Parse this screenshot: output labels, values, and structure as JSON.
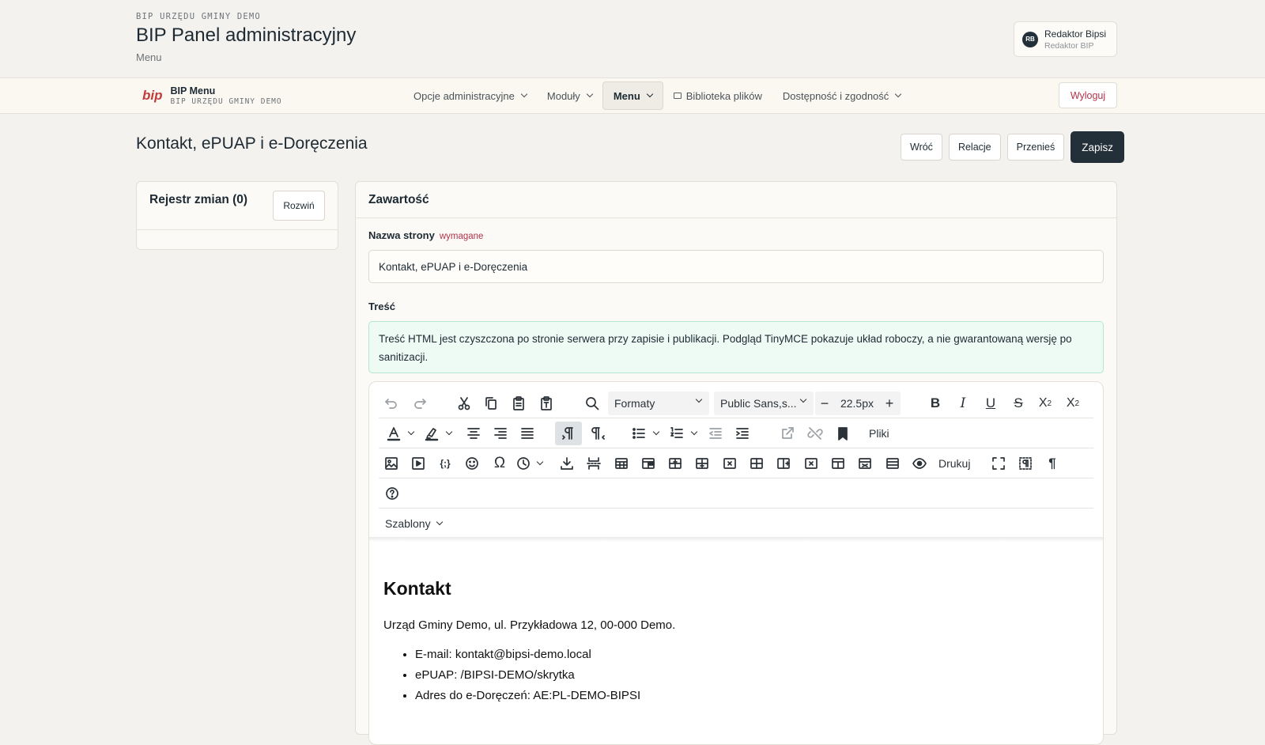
{
  "header": {
    "org": "BIP URZĘDU GMINY DEMO",
    "title": "BIP Panel administracyjny",
    "subtitle": "Menu",
    "user": {
      "initials": "RB",
      "name": "Redaktor Bipsi",
      "role": "Redaktor BIP"
    }
  },
  "nav": {
    "logo": "bip",
    "brand_name": "BIP Menu",
    "brand_org": "BIP URZĘDU GMINY DEMO",
    "items": [
      {
        "label": "Opcje administracyjne"
      },
      {
        "label": "Moduły"
      },
      {
        "label": "Menu",
        "active": true
      },
      {
        "label": "Biblioteka plików"
      },
      {
        "label": "Dostępność i zgodność"
      }
    ],
    "logout": "Wyloguj"
  },
  "page": {
    "title": "Kontakt, ePUAP i e-Doręczenia",
    "actions": {
      "back": "Wróć",
      "relations": "Relacje",
      "move": "Przenieś",
      "save": "Zapisz"
    }
  },
  "changelog": {
    "title": "Rejestr zmian (0)",
    "expand": "Rozwiń"
  },
  "content_panel": {
    "title": "Zawartość",
    "name_label": "Nazwa strony",
    "required": "wymagane",
    "name_value": "Kontakt, ePUAP i e-Doręczenia",
    "body_label": "Treść",
    "notice": "Treść HTML jest czyszczona po stronie serwera przy zapisie i publikacji. Podgląd TinyMCE pokazuje układ roboczy, a nie gwarantowaną wersję po sanitizacji."
  },
  "editor": {
    "formats": "Formaty",
    "font": "Public Sans,s...",
    "font_size": "22.5px",
    "files": "Pliki",
    "print": "Drukuj",
    "templates": "Szablony",
    "doc": {
      "heading": "Kontakt",
      "address": "Urząd Gminy Demo, ul. Przykładowa 12, 00-000 Demo.",
      "items": [
        "E-mail: kontakt@bipsi-demo.local",
        "ePUAP: /BIPSI-DEMO/skrytka",
        "Adres do e-Doręczeń: AE:PL-DEMO-BIPSI"
      ]
    }
  }
}
